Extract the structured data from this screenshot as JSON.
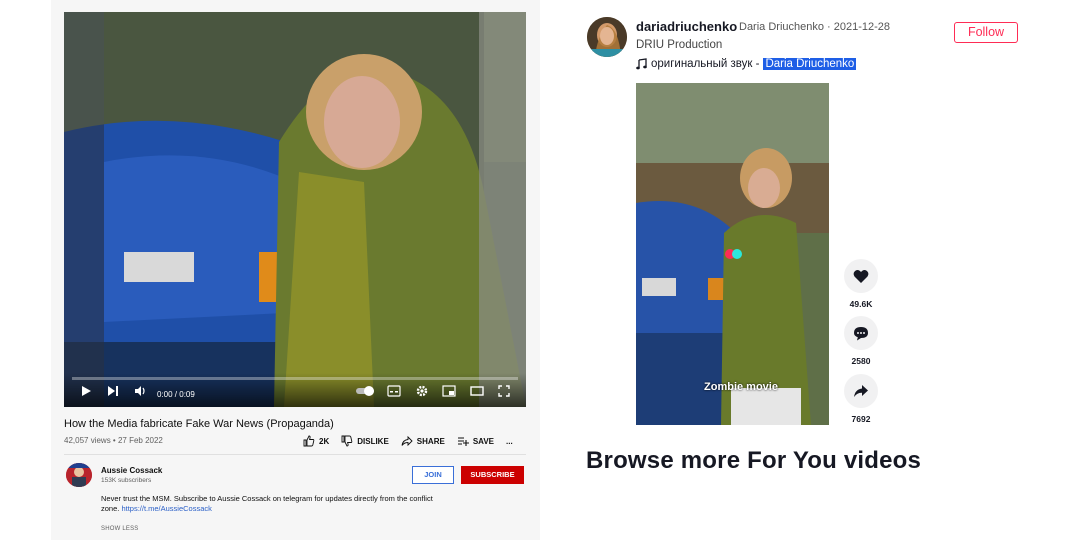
{
  "youtube": {
    "player": {
      "time": "0:00 / 0:09",
      "progress": 0
    },
    "video_title": "How the Media fabricate Fake War News (Propaganda)",
    "meta": "42,057 views • 27 Feb 2022",
    "actions": {
      "like": "2K",
      "dislike": "DISLIKE",
      "share": "SHARE",
      "save": "SAVE",
      "more": "..."
    },
    "channel": {
      "name": "Aussie Cossack",
      "subscribers": "153K subscribers",
      "join": "JOIN",
      "subscribe": "SUBSCRIBE"
    },
    "description": {
      "text": "Never trust the MSM. Subscribe to Aussie Cossack on telegram for updates directly from the conflict zone.",
      "link": "https://t.me/AussieCossack",
      "show_less": "SHOW LESS"
    }
  },
  "tiktok": {
    "username": "dariadriuchenko",
    "nickname_date": "Daria Driuchenko · 2021-12-28",
    "subtitle": "DRIU Production",
    "sound_prefix": "оригинальный звук -",
    "sound_artist": "Daria Driuchenko",
    "follow": "Follow",
    "overlay_caption": "Zombie movie",
    "likes": "49.6K",
    "comments": "2580",
    "shares": "7692",
    "browse": "Browse more For You videos"
  },
  "colors": {
    "subscribe_red": "#cc0000",
    "join_blue": "#3a6fd8",
    "tiktok_pink": "#fe2c55",
    "highlight_blue": "#1e5ee6"
  }
}
